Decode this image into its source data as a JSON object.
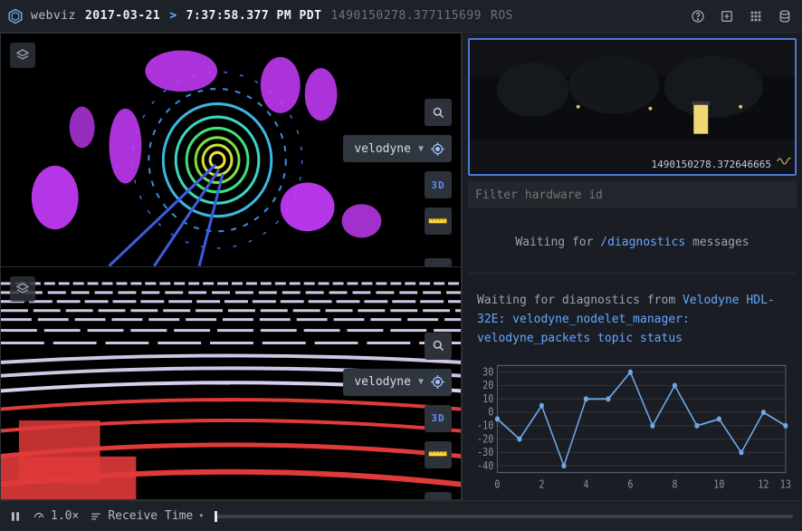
{
  "header": {
    "app_name": "webviz",
    "date": "2017-03-21",
    "caret": ">",
    "time": "7:37:58.377 PM PDT",
    "epoch": "1490150278.377115699",
    "system": "ROS"
  },
  "panels": {
    "top3d": {
      "frame": "velodyne",
      "mode3d": "3D"
    },
    "bottom3d": {
      "frame": "velodyne",
      "mode3d": "3D"
    }
  },
  "camera": {
    "timestamp": "1490150278.372646665"
  },
  "diagnostics": {
    "filter_placeholder": "Filter hardware id",
    "waiting_prefix": "Waiting for ",
    "waiting_topic": "/diagnostics",
    "waiting_suffix": " messages",
    "hw_prefix": "Waiting for diagnostics from ",
    "hw_highlight": "Velodyne HDL-32E: velodyne_nodelet_manager: velodyne_packets topic status"
  },
  "chart_data": {
    "type": "line",
    "x": [
      0,
      1,
      2,
      3,
      4,
      5,
      6,
      7,
      8,
      9,
      10,
      11,
      12,
      13
    ],
    "values": [
      -5,
      -20,
      5,
      -40,
      10,
      10,
      30,
      -10,
      20,
      -10,
      -5,
      -30,
      0,
      -10
    ],
    "xlabel": "",
    "ylabel": "",
    "y_ticks": [
      -40,
      -30,
      -20,
      -10,
      0,
      10,
      20,
      30
    ],
    "x_ticks": [
      0,
      2,
      4,
      6,
      8,
      10,
      12,
      13
    ],
    "ylim": [
      -45,
      35
    ],
    "xlim": [
      0,
      13
    ]
  },
  "playback": {
    "speed": "1.0×",
    "order_label": "Receive Time"
  }
}
